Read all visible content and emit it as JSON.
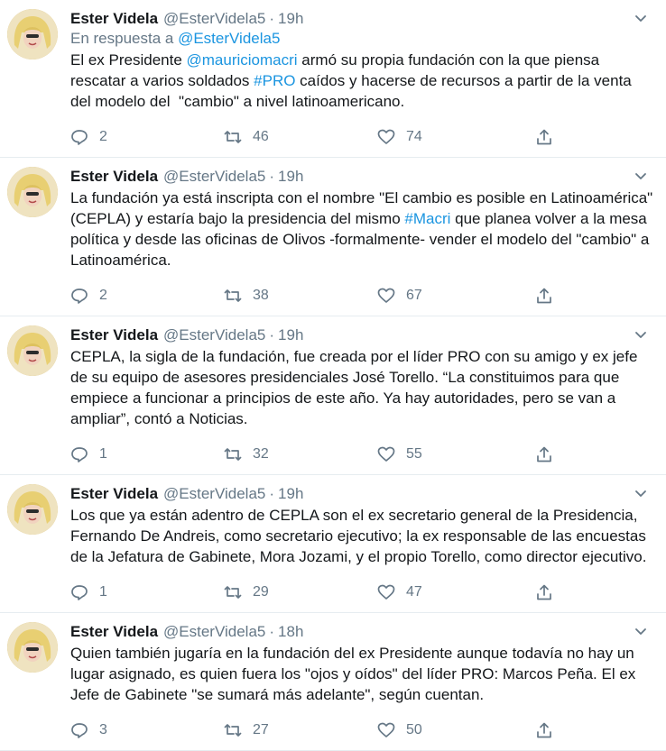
{
  "tweets": [
    {
      "name": "Ester Videla",
      "handle": "@EsterVidela5",
      "dot": "·",
      "time": "19h",
      "reply_prefix": "En respuesta a ",
      "reply_handle": "@EsterVidela5",
      "text_parts": [
        {
          "t": "El ex Presidente "
        },
        {
          "t": "@mauriciomacri",
          "link": true
        },
        {
          "t": " armó su propia fundación con la que piensa rescatar a varios soldados "
        },
        {
          "t": "#PRO",
          "link": true
        },
        {
          "t": " caídos y hacerse de recursos a partir de la venta del modelo del  \"cambio\" a nivel latinoamericano."
        }
      ],
      "replies": "2",
      "retweets": "46",
      "likes": "74"
    },
    {
      "name": "Ester Videla",
      "handle": "@EsterVidela5",
      "dot": "·",
      "time": "19h",
      "text_parts": [
        {
          "t": "La fundación ya está inscripta con el nombre \"El cambio es posible en Latinoamérica\" (CEPLA) y estaría bajo la presidencia del mismo "
        },
        {
          "t": "#Macri",
          "link": true
        },
        {
          "t": " que planea volver a la mesa política y desde las oficinas de Olivos -formalmente- vender el modelo del \"cambio\" a Latinoamérica."
        }
      ],
      "replies": "2",
      "retweets": "38",
      "likes": "67"
    },
    {
      "name": "Ester Videla",
      "handle": "@EsterVidela5",
      "dot": "·",
      "time": "19h",
      "text_parts": [
        {
          "t": "CEPLA, la sigla de la fundación, fue creada por el líder PRO con su amigo y ex jefe de su equipo de asesores presidenciales José Torello. “La constituimos para que empiece a funcionar a principios de este año. Ya hay autoridades, pero se van a ampliar”, contó a Noticias."
        }
      ],
      "replies": "1",
      "retweets": "32",
      "likes": "55"
    },
    {
      "name": "Ester Videla",
      "handle": "@EsterVidela5",
      "dot": "·",
      "time": "19h",
      "text_parts": [
        {
          "t": "Los que ya están adentro de CEPLA son el ex secretario general de la Presidencia, Fernando De Andreis, como secretario ejecutivo; la ex responsable de las encuestas de la Jefatura de Gabinete, Mora Jozami, y el propio Torello, como director ejecutivo."
        }
      ],
      "replies": "1",
      "retweets": "29",
      "likes": "47"
    },
    {
      "name": "Ester Videla",
      "handle": "@EsterVidela5",
      "dot": "·",
      "time": "18h",
      "text_parts": [
        {
          "t": "Quien también jugaría en la fundación del ex Presidente aunque todavía no hay un lugar asignado, es quien fuera los \"ojos y oídos\" del líder PRO: Marcos Peña. El ex Jefe de Gabinete \"se sumará más adelante\", según cuentan."
        }
      ],
      "replies": "3",
      "retweets": "27",
      "likes": "50"
    }
  ],
  "colors": {
    "link": "#1b95e0",
    "muted": "#657786",
    "border": "#e6ecf0"
  },
  "icons": [
    "chevron-down-icon",
    "reply-icon",
    "retweet-icon",
    "like-icon",
    "share-icon"
  ]
}
